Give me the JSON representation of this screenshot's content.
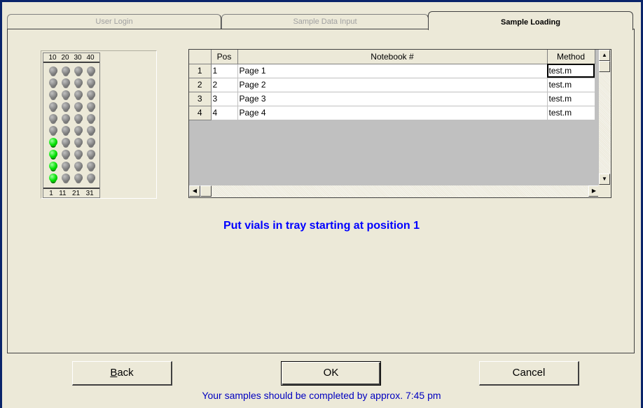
{
  "tabs": [
    {
      "label": "User Login",
      "active": false
    },
    {
      "label": "Sample Data Input",
      "active": false
    },
    {
      "label": "Sample Loading",
      "active": true
    }
  ],
  "tray": {
    "top_labels": [
      "10",
      "20",
      "30",
      "40"
    ],
    "bottom_labels": [
      "1",
      "11",
      "21",
      "31"
    ],
    "filled_positions": [
      1,
      2,
      3,
      4
    ],
    "filled_color": "#00e000",
    "empty_color": "#808080"
  },
  "grid": {
    "headers": {
      "row": "",
      "pos": "Pos",
      "notebook": "Notebook #",
      "method": "Method"
    },
    "rows": [
      {
        "num": "1",
        "pos": "1",
        "notebook": "Page 1",
        "method": "test.m"
      },
      {
        "num": "2",
        "pos": "2",
        "notebook": "Page 2",
        "method": "test.m"
      },
      {
        "num": "3",
        "pos": "3",
        "notebook": "Page 3",
        "method": "test.m"
      },
      {
        "num": "4",
        "pos": "4",
        "notebook": "Page 4",
        "method": "test.m"
      }
    ]
  },
  "message": "Put vials in tray starting at position  1",
  "buttons": {
    "back": "Back",
    "ok": "OK",
    "cancel": "Cancel"
  },
  "status": "Your samples should be completed by approx. 7:45 pm",
  "colors": {
    "message": "#0000ff",
    "status": "#0000c0",
    "background": "#ece9d8"
  }
}
